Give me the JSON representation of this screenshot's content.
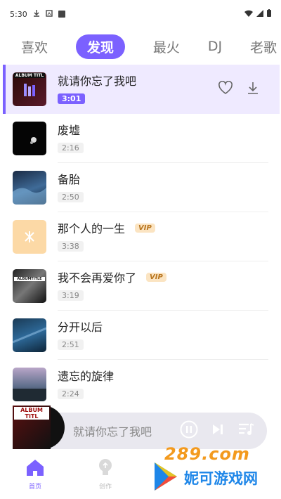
{
  "status_bar": {
    "time": "5:30"
  },
  "tabs": [
    {
      "label": "喜欢",
      "active": false
    },
    {
      "label": "发现",
      "active": true
    },
    {
      "label": "最火",
      "active": false
    },
    {
      "label": "DJ",
      "active": false
    },
    {
      "label": "老歌",
      "active": false
    }
  ],
  "songs": [
    {
      "title": "就请你忘了我吧",
      "duration": "3:01",
      "vip": false,
      "active": true,
      "cover_text": "ALBUM TITL"
    },
    {
      "title": "废墟",
      "duration": "2:16",
      "vip": false
    },
    {
      "title": "备胎",
      "duration": "2:50",
      "vip": false
    },
    {
      "title": "那个人的一生",
      "duration": "3:38",
      "vip": true,
      "vip_label": "VIP"
    },
    {
      "title": "我不会再爱你了",
      "duration": "3:19",
      "vip": true,
      "vip_label": "VIP",
      "cover_text": "ALBUMTITLE"
    },
    {
      "title": "分开以后",
      "duration": "2:51",
      "vip": false
    },
    {
      "title": "遗忘的旋律",
      "duration": "2:24",
      "vip": false
    }
  ],
  "player": {
    "title": "就请你忘了我吧",
    "cover_text": "ALBUM TITL"
  },
  "bottom_nav": [
    {
      "label": "首页",
      "icon": "home-icon",
      "active": true
    },
    {
      "label": "创作",
      "icon": "bulb-icon",
      "active": false
    }
  ],
  "watermark": {
    "site": "289.com",
    "brand": "妮可游戏网"
  },
  "colors": {
    "accent": "#7b61ff",
    "vip_text": "#b8751e",
    "vip_bg": "#fbe4c2"
  }
}
